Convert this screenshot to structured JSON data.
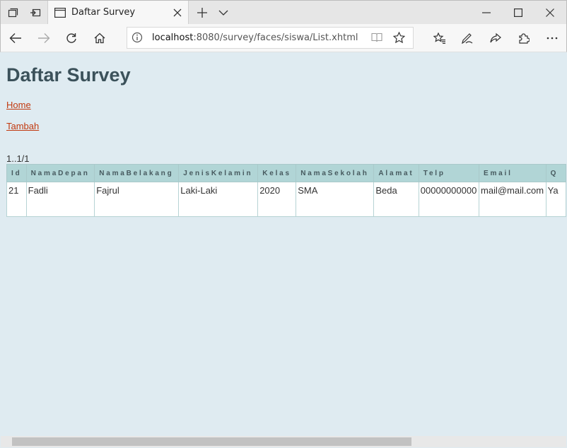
{
  "browser": {
    "tab_title": "Daftar Survey",
    "address_host": "localhost",
    "address_rest": ":8080/survey/faces/siswa/List.xhtml"
  },
  "page": {
    "title": "Daftar Survey",
    "links": {
      "home": "Home",
      "add": "Tambah"
    },
    "pager": "1..1/1"
  },
  "table": {
    "headers": [
      "Id",
      "NamaDepan",
      "NamaBelakang",
      "JenisKelamin",
      "Kelas",
      "NamaSekolah",
      "Alamat",
      "Telp",
      "Email",
      "Q"
    ],
    "rows": [
      [
        "21",
        "Fadli",
        "Fajrul",
        "Laki-Laki",
        "2020",
        "SMA",
        "Beda",
        "00000000000",
        "mail@mail.com",
        "Ya"
      ]
    ]
  }
}
